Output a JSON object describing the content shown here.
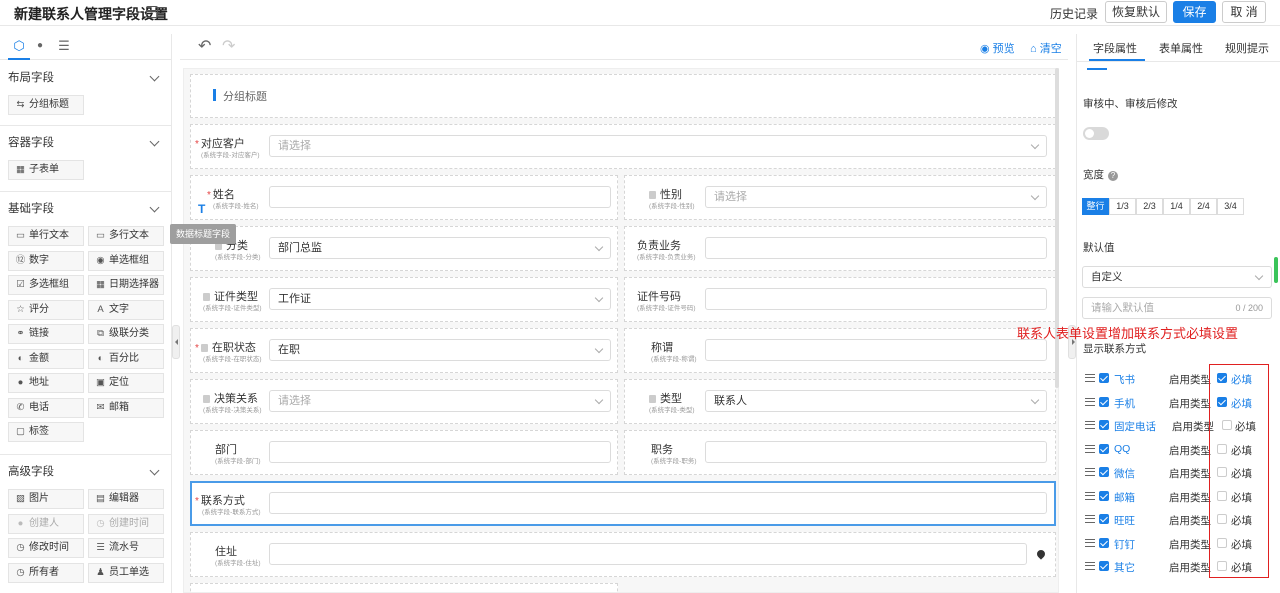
{
  "header": {
    "title": "新建联系人管理字段设置",
    "history": "历史记录",
    "restore": "恢复默认",
    "save": "保存",
    "cancel": "取 消"
  },
  "left": {
    "sections": [
      {
        "title": "布局字段",
        "items": [
          {
            "icon": "⇆",
            "label": "分组标题"
          }
        ]
      },
      {
        "title": "容器字段",
        "items": [
          {
            "icon": "▦",
            "label": "子表单"
          }
        ]
      },
      {
        "title": "基础字段",
        "items": [
          {
            "icon": "▭",
            "label": "单行文本"
          },
          {
            "icon": "▭",
            "label": "多行文本"
          },
          {
            "icon": "⑫",
            "label": "数字"
          },
          {
            "icon": "◉",
            "label": "单选框组"
          },
          {
            "icon": "☑",
            "label": "多选框组"
          },
          {
            "icon": "▦",
            "label": "日期选择器"
          },
          {
            "icon": "☆",
            "label": "评分"
          },
          {
            "icon": "A",
            "label": "文字"
          },
          {
            "icon": "⚭",
            "label": "链接"
          },
          {
            "icon": "⧉",
            "label": "级联分类"
          },
          {
            "icon": "◐",
            "label": "金额"
          },
          {
            "icon": "◐",
            "label": "百分比"
          },
          {
            "icon": "●",
            "label": "地址"
          },
          {
            "icon": "▣",
            "label": "定位"
          },
          {
            "icon": "✆",
            "label": "电话"
          },
          {
            "icon": "✉",
            "label": "邮箱"
          },
          {
            "icon": "▢",
            "label": "标签"
          }
        ]
      },
      {
        "title": "高级字段",
        "items": [
          {
            "icon": "▨",
            "label": "图片"
          },
          {
            "icon": "▤",
            "label": "编辑器"
          },
          {
            "icon": "●",
            "label": "创建人"
          },
          {
            "icon": "◷",
            "label": "创建时间"
          },
          {
            "icon": "◷",
            "label": "修改时间"
          },
          {
            "icon": "☰",
            "label": "流水号"
          },
          {
            "icon": "◷",
            "label": "所有者"
          },
          {
            "icon": "♟",
            "label": "员工单选"
          }
        ]
      }
    ]
  },
  "toolbar": {
    "preview": "预览",
    "clear": "清空"
  },
  "canvas": {
    "group_title": "分组标题",
    "tooltip": "数据标题字段",
    "fields": {
      "customer": {
        "label": "对应客户",
        "sub": "(系统字段-对应客户)",
        "value": "请选择"
      },
      "name": {
        "label": "姓名",
        "sub": "(系统字段-姓名)",
        "value": ""
      },
      "gender": {
        "label": "性别",
        "sub": "(系统字段-性别)",
        "value": "请选择"
      },
      "category": {
        "label": "分类",
        "sub": "(系统字段-分类)",
        "value": "部门总监"
      },
      "business": {
        "label": "负责业务",
        "sub": "(系统字段-负责业务)",
        "value": ""
      },
      "idtype": {
        "label": "证件类型",
        "sub": "(系统字段-证件类型)",
        "value": "工作证"
      },
      "idno": {
        "label": "证件号码",
        "sub": "(系统字段-证件号码)",
        "value": ""
      },
      "status": {
        "label": "在职状态",
        "sub": "(系统字段-在职状态)",
        "value": "在职"
      },
      "title": {
        "label": "称谓",
        "sub": "(系统字段-称谓)",
        "value": ""
      },
      "decision": {
        "label": "决策关系",
        "sub": "(系统字段-决策关系)",
        "value": "请选择"
      },
      "type": {
        "label": "类型",
        "sub": "(系统字段-类型)",
        "value": "联系人"
      },
      "dept": {
        "label": "部门",
        "sub": "(系统字段-部门)",
        "value": ""
      },
      "position": {
        "label": "职务",
        "sub": "(系统字段-职务)",
        "value": ""
      },
      "contact": {
        "label": "联系方式",
        "sub": "(系统字段-联系方式)",
        "value": ""
      },
      "address": {
        "label": "住址",
        "sub": "(系统字段-住址)",
        "value": ""
      }
    }
  },
  "right": {
    "tabs": [
      "字段属性",
      "表单属性",
      "规则提示"
    ],
    "review_label": "审核中、审核后修改",
    "width_label": "宽度",
    "width_options": [
      "整行",
      "1/3",
      "2/3",
      "1/4",
      "2/4",
      "3/4"
    ],
    "default_label": "默认值",
    "default_select": "自定义",
    "default_placeholder": "请输入默认值",
    "default_count": "0 / 200",
    "show_contact_label": "显示联系方式",
    "annotation": "联系人表单设置增加联系方式必填设置",
    "contacts": [
      {
        "name": "飞书",
        "type": "启用类型",
        "req": "必填",
        "required": true
      },
      {
        "name": "手机",
        "type": "启用类型",
        "req": "必填",
        "required": true
      },
      {
        "name": "固定电话",
        "type": "启用类型",
        "req": "必填",
        "required": false
      },
      {
        "name": "QQ",
        "type": "启用类型",
        "req": "必填",
        "required": false
      },
      {
        "name": "微信",
        "type": "启用类型",
        "req": "必填",
        "required": false
      },
      {
        "name": "邮箱",
        "type": "启用类型",
        "req": "必填",
        "required": false
      },
      {
        "name": "旺旺",
        "type": "启用类型",
        "req": "必填",
        "required": false
      },
      {
        "name": "钉钉",
        "type": "启用类型",
        "req": "必填",
        "required": false
      },
      {
        "name": "其它",
        "type": "启用类型",
        "req": "必填",
        "required": false
      }
    ]
  },
  "colors": {
    "accent": "#1a7fe6",
    "annotation": "#e02020"
  }
}
